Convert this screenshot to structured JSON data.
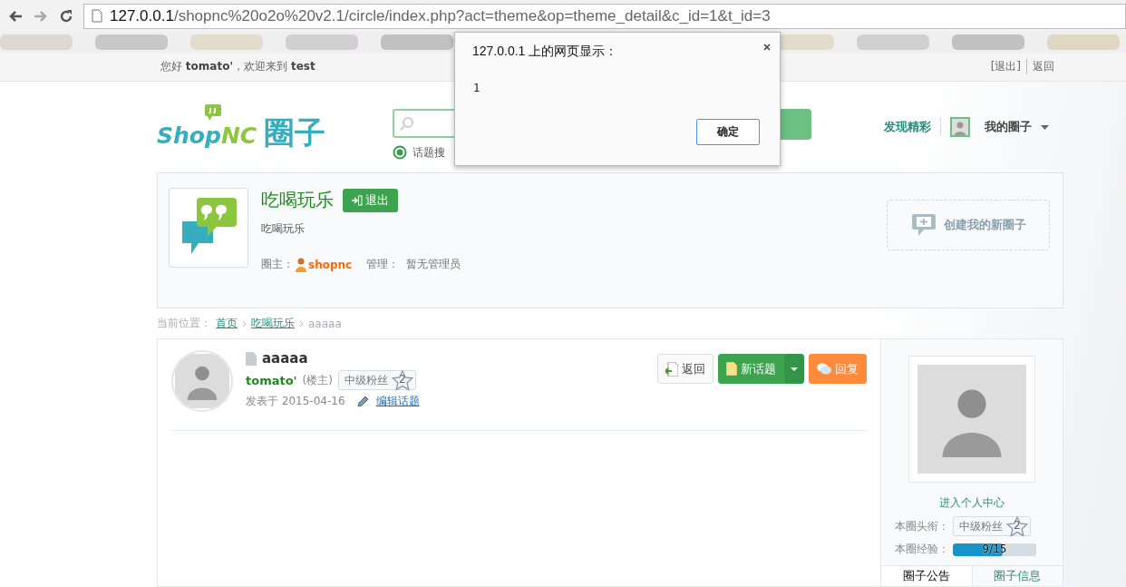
{
  "browser": {
    "url_host": "127.0.0.1",
    "url_path": "/shopnc%20o2o%20v2.1/circle/index.php?act=theme&op=theme_detail&c_id=1&t_id=3"
  },
  "topbar": {
    "greeting": "您好 **tomato'**，欢迎来到 **test**",
    "links": [
      "[退出]",
      "返回"
    ]
  },
  "header": {
    "logo": {
      "part1": "Shop",
      "part2": "NC",
      "part3": "圈子"
    },
    "search": {
      "option": "话题搜",
      "selected": true
    },
    "nav": [
      "发现精彩"
    ],
    "my_circle": "我的圈子"
  },
  "circle": {
    "name": "吃喝玩乐",
    "quit_button": "退出",
    "description": "吃喝玩乐",
    "owner_label": "圈主：",
    "owner": "shopnc",
    "admin_label": "管理：",
    "admin": "暂无管理员",
    "create_button": "创建我的新圈子"
  },
  "breadcrumb": {
    "label": "当前位置：",
    "items": [
      {
        "text": "首页",
        "link": true
      },
      {
        "text": "吃喝玩乐",
        "link": true
      },
      {
        "text": "aaaaa",
        "link": false
      }
    ]
  },
  "topic": {
    "title": "aaaaa",
    "author": "tomato'",
    "author_role": "(楼主)",
    "rank": "中级粉丝",
    "rank_level": "2",
    "posted": "发表于 2015-04-16",
    "edit_link": "编辑话题",
    "buttons": [
      {
        "kind": "back",
        "label": "返回"
      },
      {
        "kind": "new",
        "label": "新话题"
      },
      {
        "kind": "reply",
        "label": "回复"
      }
    ]
  },
  "sidebar": {
    "profile_link": "进入个人中心",
    "title_label": "本圈头衔：",
    "rank": "中级粉丝",
    "rank_level": "2",
    "exp_label": "本圈经验：",
    "exp": "9/15",
    "level": 0.6,
    "tabs": [
      {
        "label": "圈子公告",
        "selected": true
      },
      {
        "label": "圈子信息",
        "selected": false
      }
    ]
  },
  "dialog": {
    "title": "127.0.0.1 上的网页显示：",
    "message": "1",
    "ok": "确定"
  }
}
